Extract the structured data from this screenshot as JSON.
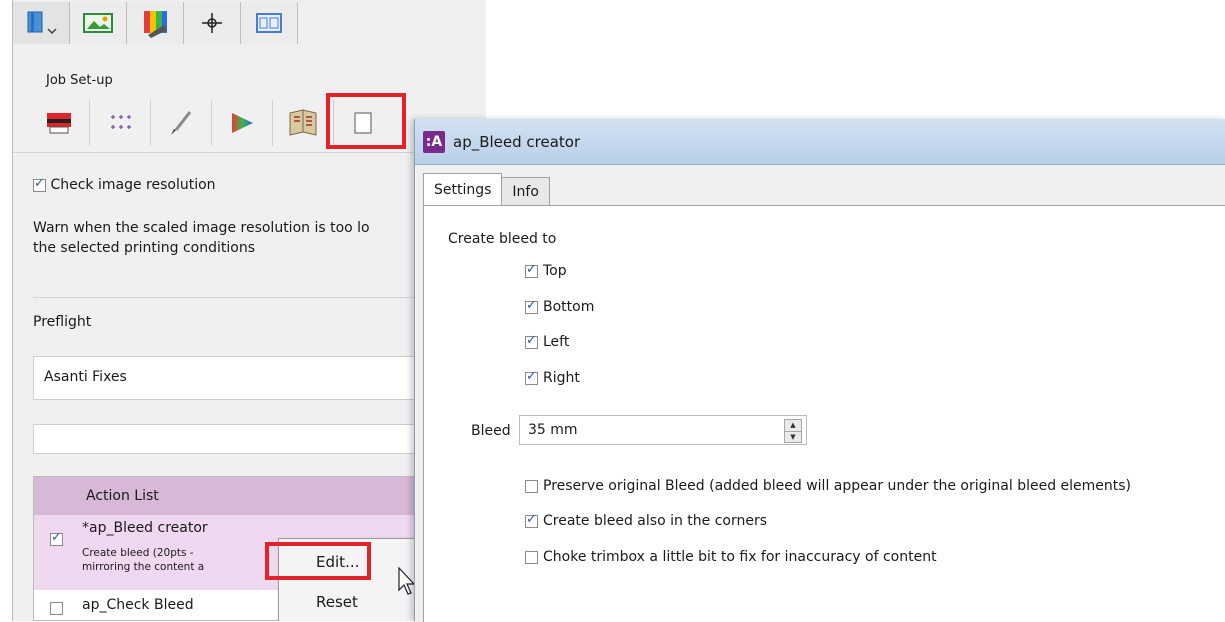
{
  "left_panel": {
    "section_title": "Job Set-up",
    "check_image_resolution": {
      "label": "Check image resolution",
      "checked": true
    },
    "warn_text_line1": "Warn when the scaled image resolution is too lo",
    "warn_text_line2": "the selected printing conditions",
    "preflight_label": "Preflight",
    "preflight_value": "Asanti Fixes",
    "action_list": {
      "header": "Action List",
      "items": [
        {
          "title": "*ap_Bleed creator",
          "desc_line1": "Create bleed (20pts -",
          "desc_line2": "mirroring the content a",
          "checked": true
        },
        {
          "title": "ap_Check Bleed",
          "checked": false
        }
      ]
    },
    "context_menu": {
      "items": [
        "Edit...",
        "Reset"
      ]
    }
  },
  "dialog": {
    "title": "ap_Bleed creator",
    "icon_text": ":A",
    "tabs": [
      "Settings",
      "Info"
    ],
    "active_tab": "Settings",
    "create_bleed_label": "Create bleed to",
    "sides": [
      {
        "label": "Top",
        "checked": true
      },
      {
        "label": "Bottom",
        "checked": true
      },
      {
        "label": "Left",
        "checked": true
      },
      {
        "label": "Right",
        "checked": true
      }
    ],
    "bleed_label": "Bleed",
    "bleed_value": "35 mm",
    "options": [
      {
        "label": "Preserve original Bleed (added bleed will appear under the original bleed elements)",
        "checked": false
      },
      {
        "label": "Create bleed also in the corners",
        "checked": true
      },
      {
        "label": "Choke trimbox a little bit to fix for inaccuracy of content",
        "checked": false
      }
    ]
  },
  "colors": {
    "highlight": "#e2232a",
    "action_header": "#d6b8d7",
    "action_row": "#efd9f0"
  }
}
